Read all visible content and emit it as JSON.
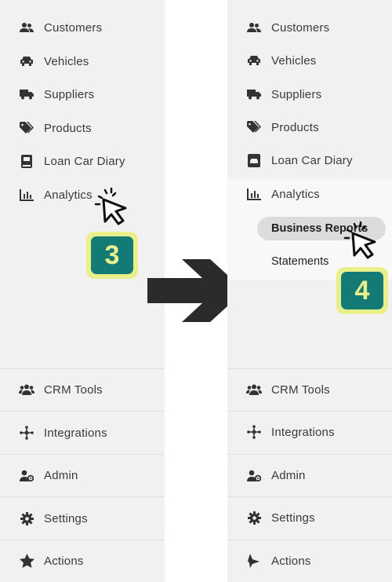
{
  "left": {
    "items": [
      {
        "label": "Customers",
        "icon": "customers-icon"
      },
      {
        "label": "Vehicles",
        "icon": "car-icon"
      },
      {
        "label": "Suppliers",
        "icon": "truck-icon"
      },
      {
        "label": "Products",
        "icon": "tags-icon"
      },
      {
        "label": "Loan Car Diary",
        "icon": "book-icon"
      },
      {
        "label": "Analytics",
        "icon": "chart-icon"
      }
    ],
    "bottom": [
      {
        "label": "CRM Tools",
        "icon": "users-icon"
      },
      {
        "label": "Integrations",
        "icon": "integrations-icon"
      },
      {
        "label": "Admin",
        "icon": "admin-icon"
      },
      {
        "label": "Settings",
        "icon": "gear-icon"
      },
      {
        "label": "Actions",
        "icon": "star-icon"
      }
    ],
    "step": "3"
  },
  "right": {
    "items": [
      {
        "label": "Customers",
        "icon": "customers-icon"
      },
      {
        "label": "Vehicles",
        "icon": "car-icon"
      },
      {
        "label": "Suppliers",
        "icon": "truck-icon"
      },
      {
        "label": "Products",
        "icon": "tags-icon"
      },
      {
        "label": "Loan Car Diary",
        "icon": "book-icon"
      },
      {
        "label": "Analytics",
        "icon": "chart-icon"
      }
    ],
    "submenu": [
      "Business Reports",
      "Statements"
    ],
    "bottom": [
      {
        "label": "CRM Tools",
        "icon": "users-icon"
      },
      {
        "label": "Integrations",
        "icon": "integrations-icon"
      },
      {
        "label": "Admin",
        "icon": "admin-icon"
      },
      {
        "label": "Settings",
        "icon": "gear-icon"
      },
      {
        "label": "Actions",
        "icon": "actions-icon"
      }
    ],
    "step": "4"
  },
  "colors": {
    "badge_fill": "#137a76",
    "badge_border": "#e9ef8a",
    "arrow": "#2b2b2b",
    "sidebar_bg": "#f1f1f1"
  }
}
